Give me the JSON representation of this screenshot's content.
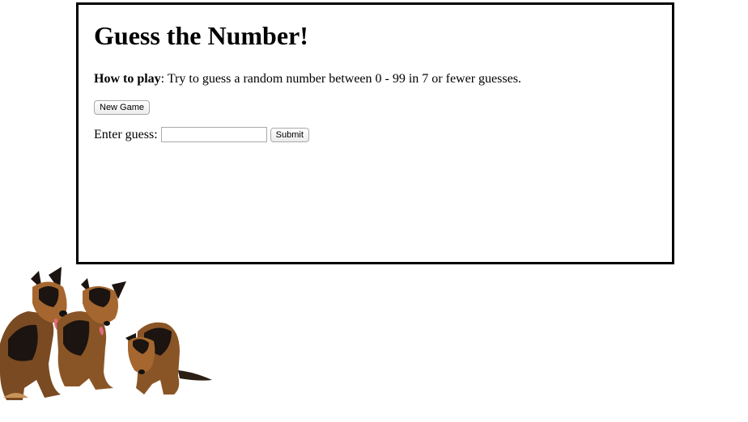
{
  "game": {
    "title": "Guess the Number!",
    "how_to_label": "How to play",
    "how_to_text": ": Try to guess a random number between 0 - 99 in 7 or fewer guesses.",
    "new_game_label": "New Game",
    "guess_label": "Enter guess:",
    "guess_value": "",
    "submit_label": "Submit"
  },
  "decoration": {
    "image": "three-german-shepherd-puppies"
  }
}
